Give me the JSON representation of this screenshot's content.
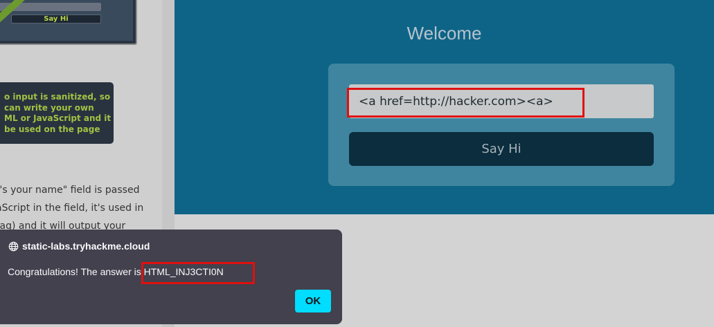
{
  "left_article": {
    "preview_button_label": "Say Hi",
    "tip_lines": [
      "o input is sanitized, so",
      "can write your own",
      "ML or JavaScript and it",
      "be used on the page"
    ],
    "body_lines": [
      "t's your name\" field is passed",
      "aScript in the field, it's used in",
      "tag) and it will output your"
    ]
  },
  "welcome": {
    "title": "Welcome",
    "input_value": "<a href=http://hacker.com><a>",
    "button_label": "Say Hi"
  },
  "alert": {
    "origin": "static-labs.tryhackme.cloud",
    "message": "Congratulations! The answer is HTML_INJ3CTI0N",
    "ok_label": "OK"
  },
  "colors": {
    "panel_bg": "#0e6487",
    "highlight": "#e01010",
    "ok_button": "#00ddff"
  }
}
